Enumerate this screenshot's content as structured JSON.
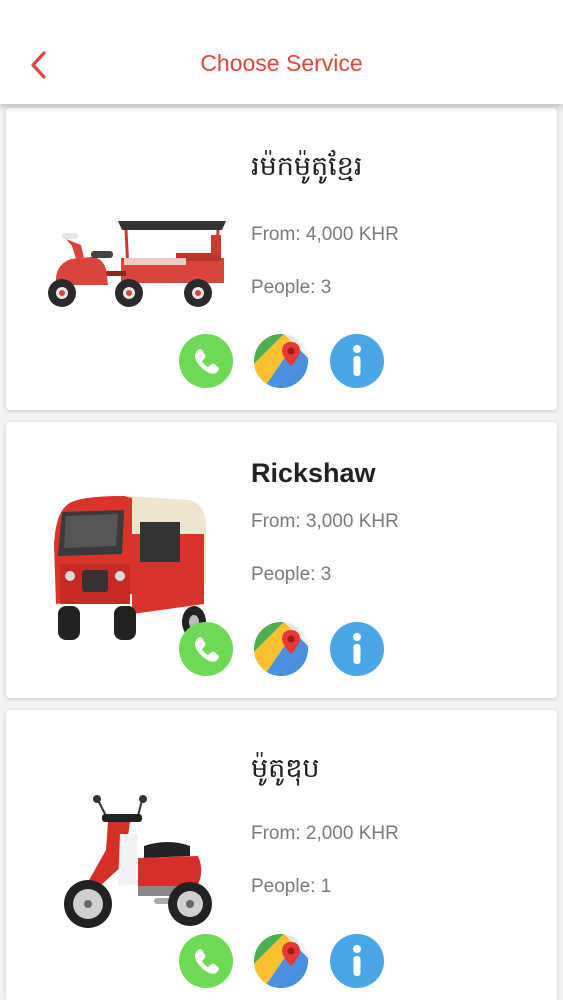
{
  "header": {
    "title": "Choose Service",
    "accent_color": "#e0463a"
  },
  "services": [
    {
      "name": "រម៉កម៉ូតូខ្មែរ",
      "price": "From: 4,000 KHR",
      "people": "People: 3",
      "vehicle_icon": "remork-moto-image"
    },
    {
      "name": "Rickshaw",
      "price": "From: 3,000 KHR",
      "people": "People: 3",
      "vehicle_icon": "rickshaw-image"
    },
    {
      "name": "ម៉ូតូឌុប",
      "price": "From: 2,000 KHR",
      "people": "People: 1",
      "vehicle_icon": "motorbike-image"
    }
  ],
  "actions": {
    "call_icon": "phone-icon",
    "map_icon": "maps-icon",
    "info_icon": "info-icon",
    "call_color": "#6fd955",
    "info_color": "#4aa6e6"
  }
}
